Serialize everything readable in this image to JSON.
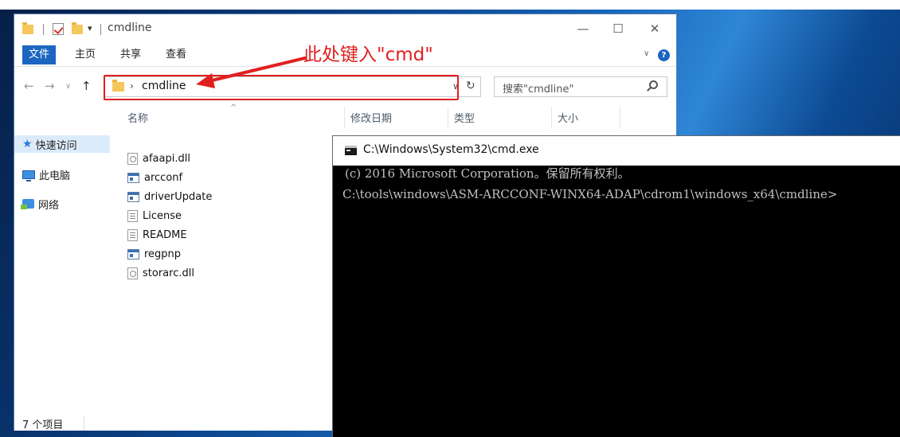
{
  "explorer": {
    "title": "cmdline",
    "quick_access_dropdown": "▾",
    "window_controls": {
      "minimize": "—",
      "maximize": "☐",
      "close": "✕"
    },
    "ribbon": {
      "file_tab": "文件",
      "tabs": [
        "主页",
        "共享",
        "查看"
      ],
      "expand": "∨",
      "help": "?"
    },
    "nav_buttons": {
      "back": "←",
      "forward": "→",
      "recent": "∨",
      "up": "↑"
    },
    "address": {
      "chevron": "›",
      "path": "cmdline",
      "dropdown": "∨",
      "refresh": "↻"
    },
    "search": {
      "placeholder": "搜索\"cmdline\""
    },
    "sidebar": {
      "items": [
        {
          "label": "快速访问",
          "icon": "star-icon"
        },
        {
          "label": "此电脑",
          "icon": "computer-icon"
        },
        {
          "label": "网络",
          "icon": "network-icon"
        }
      ]
    },
    "columns": [
      "名称",
      "修改日期",
      "类型",
      "大小"
    ],
    "sort_indicator": "^",
    "files": [
      {
        "name": "afaapi.dll",
        "icon": "dll-file-icon"
      },
      {
        "name": "arcconf",
        "icon": "application-icon"
      },
      {
        "name": "driverUpdate",
        "icon": "application-icon"
      },
      {
        "name": "License",
        "icon": "text-file-icon"
      },
      {
        "name": "README",
        "icon": "text-file-icon"
      },
      {
        "name": "regpnp",
        "icon": "application-icon"
      },
      {
        "name": "storarc.dll",
        "icon": "dll-file-icon"
      }
    ],
    "status": "7 个项目"
  },
  "annotation": {
    "text": "此处键入\"cmd\"",
    "color": "#e02020"
  },
  "cmd": {
    "title": "C:\\Windows\\System32\\cmd.exe",
    "lines": [
      "(c) 2016 Microsoft Corporation。保留所有权利。",
      "C:\\tools\\windows\\ASM-ARCCONF-WINX64-ADAP\\cdrom1\\windows_x64\\cmdline>"
    ]
  },
  "colors": {
    "accent": "#1c66c2",
    "highlight": "#e02020",
    "console_bg": "#000000",
    "console_text": "#c0c0c0"
  }
}
